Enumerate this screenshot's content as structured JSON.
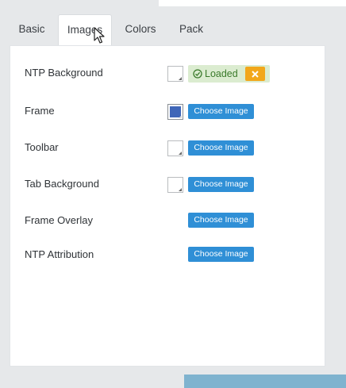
{
  "tabs": [
    {
      "label": "Basic",
      "active": false
    },
    {
      "label": "Images",
      "active": true
    },
    {
      "label": "Colors",
      "active": false
    },
    {
      "label": "Pack",
      "active": false
    }
  ],
  "rows": [
    {
      "label": "NTP Background",
      "swatch": "white",
      "status": "Loaded",
      "clear_icon": "close-icon"
    },
    {
      "label": "Frame",
      "swatch": "#3f66b8",
      "button": "Choose Image"
    },
    {
      "label": "Toolbar",
      "swatch": "white",
      "button": "Choose Image"
    },
    {
      "label": "Tab Background",
      "swatch": "white",
      "button": "Choose Image"
    },
    {
      "label": "Frame Overlay",
      "button": "Choose Image"
    },
    {
      "label": "NTP Attribution",
      "button": "Choose Image"
    }
  ],
  "colors": {
    "button": "#2f8fd6",
    "loaded_bg": "#dbecd0",
    "loaded_text": "#3a7a2a",
    "clear_button": "#f2a71b",
    "frame_swatch": "#3f66b8"
  }
}
